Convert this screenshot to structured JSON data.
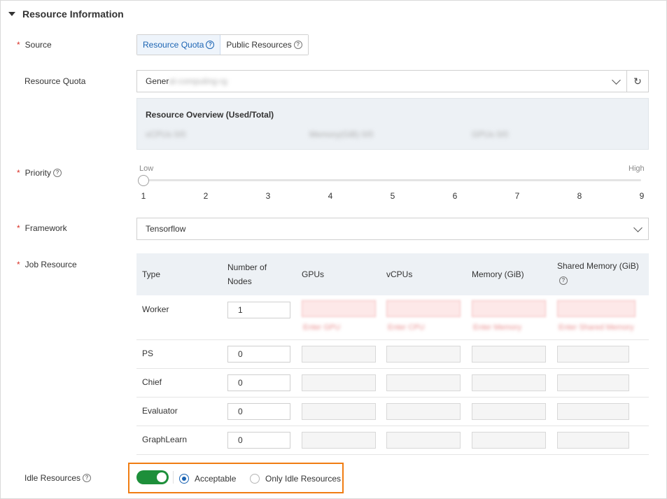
{
  "section": {
    "title": "Resource Information"
  },
  "source": {
    "label": "Source",
    "options": [
      {
        "label": "Resource Quota",
        "selected": true
      },
      {
        "label": "Public Resources",
        "selected": false
      }
    ]
  },
  "resource_quota": {
    "label": "Resource Quota",
    "value": "Gener",
    "value_blurred": "al-computing-rg",
    "overview_title": "Resource Overview (Used/Total)",
    "overview_items": [
      "vCPUs 0/0",
      "Memory(GiB) 0/0",
      "GPUs 0/0"
    ]
  },
  "priority": {
    "label": "Priority",
    "low_label": "Low",
    "high_label": "High",
    "ticks": [
      "1",
      "2",
      "3",
      "4",
      "5",
      "6",
      "7",
      "8",
      "9"
    ],
    "value": 1
  },
  "framework": {
    "label": "Framework",
    "value": "Tensorflow"
  },
  "job_resource": {
    "label": "Job Resource",
    "columns": [
      "Type",
      "Number of Nodes",
      "GPUs",
      "vCPUs",
      "Memory (GiB)",
      "Shared Memory (GiB)"
    ],
    "rows": [
      {
        "type": "Worker",
        "nodes": "1",
        "errors": [
          "Enter GPU",
          "Enter CPU",
          "Enter Memory",
          "Enter Shared Memory"
        ]
      },
      {
        "type": "PS",
        "nodes": "0"
      },
      {
        "type": "Chief",
        "nodes": "0"
      },
      {
        "type": "Evaluator",
        "nodes": "0"
      },
      {
        "type": "GraphLearn",
        "nodes": "0"
      }
    ]
  },
  "idle_resources": {
    "label": "Idle Resources",
    "toggle_on": true,
    "options": [
      {
        "label": "Acceptable",
        "selected": true
      },
      {
        "label": "Only Idle Resources",
        "selected": false
      }
    ]
  },
  "colors": {
    "accent": "#1b64b3",
    "required": "#d93026",
    "toggle": "#1d8f3a",
    "highlight": "#f07d13"
  }
}
